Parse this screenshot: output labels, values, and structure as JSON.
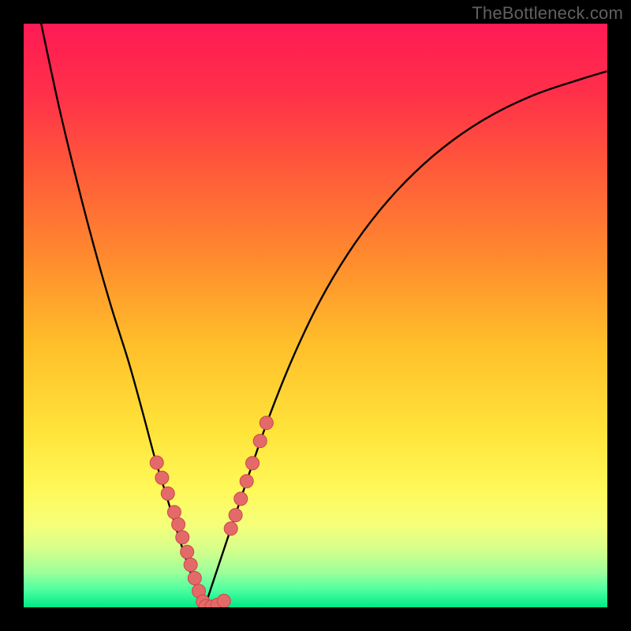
{
  "watermark": "TheBottleneck.com",
  "colors": {
    "frame": "#000000",
    "curve_stroke": "#000000",
    "marker_fill": "#e46a6a",
    "marker_stroke": "#c94848",
    "gradient_stops": [
      {
        "t": 0.0,
        "c": "#ff1a55"
      },
      {
        "t": 0.12,
        "c": "#ff3049"
      },
      {
        "t": 0.25,
        "c": "#ff5a3a"
      },
      {
        "t": 0.4,
        "c": "#ff8a2e"
      },
      {
        "t": 0.55,
        "c": "#ffbf2a"
      },
      {
        "t": 0.7,
        "c": "#ffe43a"
      },
      {
        "t": 0.8,
        "c": "#fff95a"
      },
      {
        "t": 0.86,
        "c": "#f5ff7a"
      },
      {
        "t": 0.9,
        "c": "#d6ff8a"
      },
      {
        "t": 0.94,
        "c": "#9dff9a"
      },
      {
        "t": 0.97,
        "c": "#4dffa0"
      },
      {
        "t": 1.0,
        "c": "#00e886"
      }
    ]
  },
  "chart_data": {
    "type": "line",
    "title": "",
    "xlabel": "",
    "ylabel": "",
    "xlim": [
      0,
      1
    ],
    "ylim": [
      0,
      1
    ],
    "series": [
      {
        "name": "left-branch",
        "x": [
          0.03,
          0.06,
          0.09,
          0.12,
          0.15,
          0.18,
          0.205,
          0.225,
          0.245,
          0.262,
          0.278,
          0.292,
          0.302,
          0.31
        ],
        "y": [
          1.0,
          0.86,
          0.735,
          0.62,
          0.515,
          0.42,
          0.33,
          0.255,
          0.19,
          0.133,
          0.083,
          0.043,
          0.016,
          0.0
        ]
      },
      {
        "name": "right-branch",
        "x": [
          0.31,
          0.33,
          0.355,
          0.385,
          0.42,
          0.46,
          0.505,
          0.555,
          0.61,
          0.67,
          0.735,
          0.805,
          0.88,
          0.955,
          0.998
        ],
        "y": [
          0.0,
          0.06,
          0.135,
          0.225,
          0.325,
          0.425,
          0.52,
          0.605,
          0.68,
          0.745,
          0.8,
          0.845,
          0.88,
          0.905,
          0.918
        ]
      }
    ],
    "markers": [
      {
        "name": "left-cluster",
        "x": [
          0.228,
          0.237,
          0.247,
          0.258,
          0.265,
          0.272,
          0.28,
          0.286,
          0.293,
          0.3,
          0.307
        ],
        "y": [
          0.248,
          0.222,
          0.195,
          0.163,
          0.142,
          0.12,
          0.095,
          0.073,
          0.05,
          0.028,
          0.01
        ]
      },
      {
        "name": "bottom-cluster",
        "x": [
          0.312,
          0.322,
          0.332,
          0.343
        ],
        "y": [
          0.002,
          0.001,
          0.004,
          0.011
        ]
      },
      {
        "name": "right-cluster",
        "x": [
          0.355,
          0.363,
          0.372,
          0.382,
          0.392,
          0.405,
          0.416
        ],
        "y": [
          0.135,
          0.158,
          0.186,
          0.216,
          0.247,
          0.285,
          0.316
        ]
      }
    ]
  }
}
